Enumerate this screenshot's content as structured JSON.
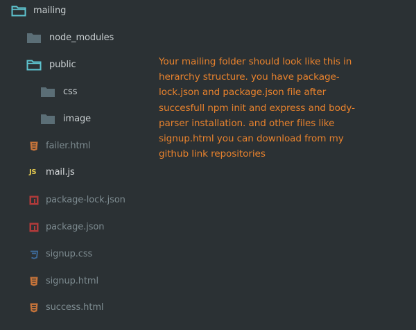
{
  "tree": {
    "items": [
      {
        "name": "mailing",
        "kind": "folder-open",
        "icon": "folder-open-icon"
      },
      {
        "name": "node_modules",
        "kind": "folder-closed",
        "icon": "folder-icon"
      },
      {
        "name": "public",
        "kind": "folder-open",
        "icon": "folder-open-icon"
      },
      {
        "name": "css",
        "kind": "folder-closed",
        "icon": "folder-icon"
      },
      {
        "name": "image",
        "kind": "folder-closed",
        "icon": "folder-icon"
      },
      {
        "name": "failer.html",
        "kind": "html",
        "icon": "html5-icon"
      },
      {
        "name": "mail.js",
        "kind": "js",
        "icon": "javascript-icon",
        "icon_text": "JS"
      },
      {
        "name": "package-lock.json",
        "kind": "npm",
        "icon": "npm-icon"
      },
      {
        "name": "package.json",
        "kind": "npm",
        "icon": "npm-icon"
      },
      {
        "name": "signup.css",
        "kind": "css",
        "icon": "css3-icon"
      },
      {
        "name": "signup.html",
        "kind": "html",
        "icon": "html5-icon"
      },
      {
        "name": "success.html",
        "kind": "html",
        "icon": "html5-icon"
      }
    ]
  },
  "note": {
    "text": "Your mailing folder should look like this in\nherarchy structure. you have package-\nlock.json and package.json file after\nsuccesfull npm init and express and body-\nparser installation. and other files like\nsignup.html you can download from my\ngithub link repositories"
  },
  "colors": {
    "background": "#2b3134",
    "folder_open": "#5ec4cf",
    "folder_closed": "#5b6e76",
    "html": "#c7743a",
    "js": "#e3c94f",
    "npm": "#b03a3a",
    "css": "#3e6d9e",
    "note_text": "#e8822d"
  }
}
